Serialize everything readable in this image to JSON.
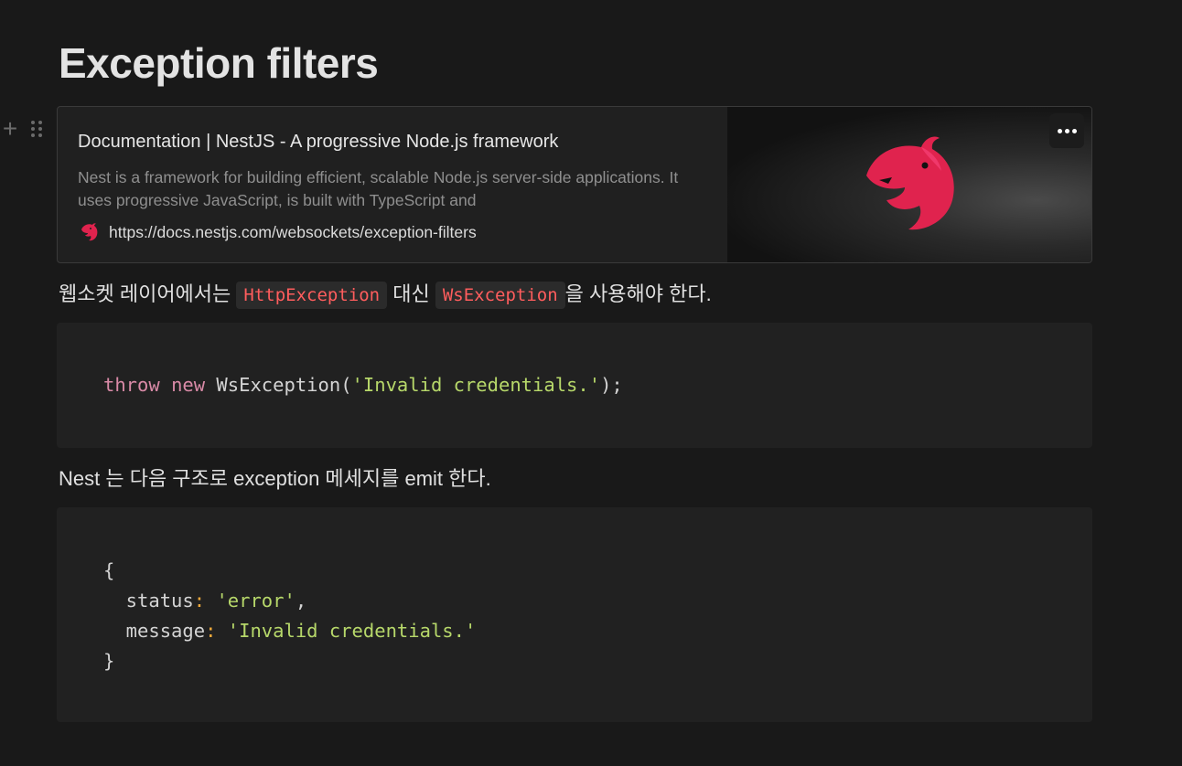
{
  "page": {
    "title": "Exception filters"
  },
  "bookmark": {
    "title": "Documentation | NestJS - A progressive Node.js framework",
    "description": "Nest is a framework for building efficient, scalable Node.js server-side applications. It uses progressive JavaScript, is built with TypeScript and",
    "url": "https://docs.nestjs.com/websockets/exception-filters",
    "favicon": "nestjs-logo-icon",
    "more_icon": "more-dots-icon"
  },
  "paragraph1": {
    "before": "웹소켓 레이어에서는 ",
    "code1": "HttpException",
    "middle": " 대신 ",
    "code2": "WsException",
    "after": "을 사용해야 한다."
  },
  "code_block1": {
    "keyword_throw": "throw",
    "keyword_new": "new",
    "class_name": " WsException",
    "open_paren": "(",
    "string": "'Invalid credentials.'",
    "close": ");"
  },
  "paragraph2": {
    "text": "Nest 는 다음 구조로 exception 메세지를 emit 한다."
  },
  "code_block2": {
    "open_brace": "{",
    "status_key": "  status",
    "status_value": "'error'",
    "comma": ",",
    "message_key": "  message",
    "message_value": "'Invalid credentials.'",
    "close_brace": "}",
    "colon": ":"
  },
  "colors": {
    "background": "#191919",
    "inline_code": "#ff5d5d",
    "keyword": "#d98aa7",
    "string": "#b7d86a",
    "nest_red": "#e0234e"
  }
}
